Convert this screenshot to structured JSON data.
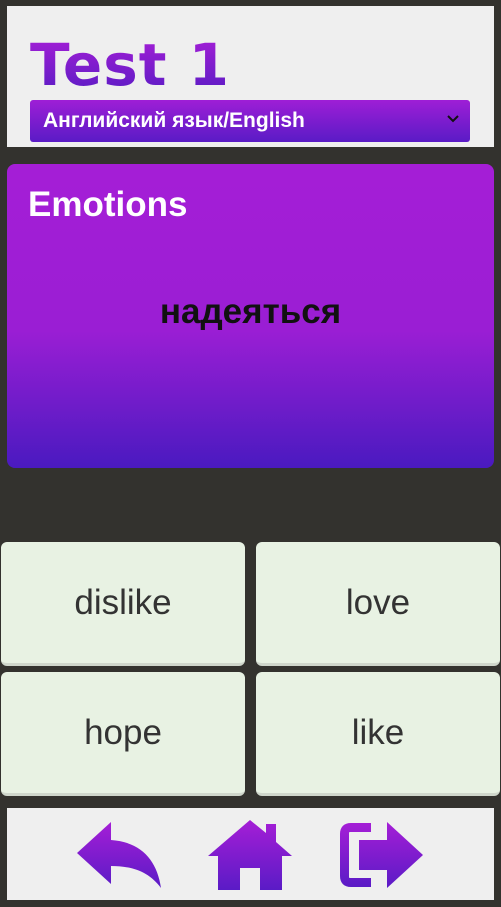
{
  "header": {
    "title": "Test 1",
    "language_select": {
      "selected": "Английский язык/English",
      "icon": "chevron-down-icon"
    }
  },
  "card": {
    "topic": "Emotions",
    "word": "надеяться"
  },
  "answers": [
    "dislike",
    "love",
    "hope",
    "like"
  ],
  "footer": {
    "icons": [
      "back-icon",
      "home-icon",
      "exit-icon"
    ]
  },
  "colors": {
    "accent_top": "#a51ed6",
    "accent_bottom": "#5a1bc6",
    "background": "#33322e",
    "answer_bg": "#e8f2e3",
    "panel_bg": "#efefef"
  }
}
